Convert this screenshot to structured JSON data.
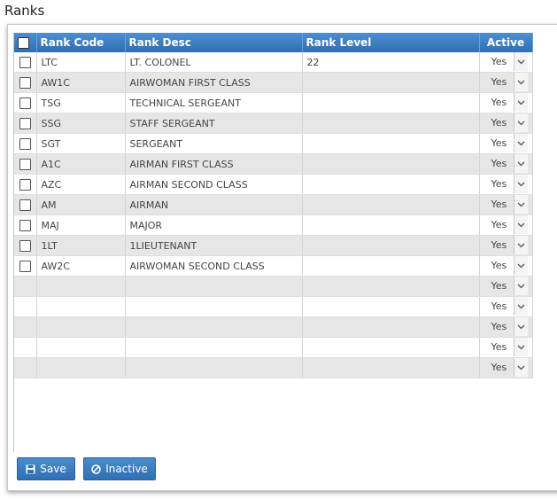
{
  "page": {
    "title": "Ranks"
  },
  "grid": {
    "columns": {
      "code": "Rank Code",
      "desc": "Rank Desc",
      "level": "Rank Level",
      "active": "Active"
    },
    "rows": [
      {
        "code": "LTC",
        "desc": "LT. COLONEL",
        "level": "22",
        "active": "Yes"
      },
      {
        "code": "AW1C",
        "desc": "AIRWOMAN FIRST CLASS",
        "level": "",
        "active": "Yes"
      },
      {
        "code": "TSG",
        "desc": "TECHNICAL SERGEANT",
        "level": "",
        "active": "Yes"
      },
      {
        "code": "SSG",
        "desc": "STAFF SERGEANT",
        "level": "",
        "active": "Yes"
      },
      {
        "code": "SGT",
        "desc": "SERGEANT",
        "level": "",
        "active": "Yes"
      },
      {
        "code": "A1C",
        "desc": "AIRMAN FIRST CLASS",
        "level": "",
        "active": "Yes"
      },
      {
        "code": "AZC",
        "desc": "AIRMAN SECOND CLASS",
        "level": "",
        "active": "Yes"
      },
      {
        "code": "AM",
        "desc": "AIRMAN",
        "level": "",
        "active": "Yes"
      },
      {
        "code": "MAJ",
        "desc": "MAJOR",
        "level": "",
        "active": "Yes"
      },
      {
        "code": "1LT",
        "desc": "1LIEUTENANT",
        "level": "",
        "active": "Yes"
      },
      {
        "code": "AW2C",
        "desc": "AIRWOMAN SECOND CLASS",
        "level": "",
        "active": "Yes"
      }
    ],
    "blank_rows": [
      {
        "active": "Yes"
      },
      {
        "active": "Yes"
      },
      {
        "active": "Yes"
      },
      {
        "active": "Yes"
      },
      {
        "active": "Yes"
      }
    ]
  },
  "buttons": {
    "save": {
      "label": "Save",
      "icon": "save-icon"
    },
    "inactive": {
      "label": "Inactive",
      "icon": "ban-icon"
    }
  },
  "colors": {
    "header": "#3a7dc1",
    "button": "#3a7dc1",
    "alt_row": "#e6e6e6"
  }
}
